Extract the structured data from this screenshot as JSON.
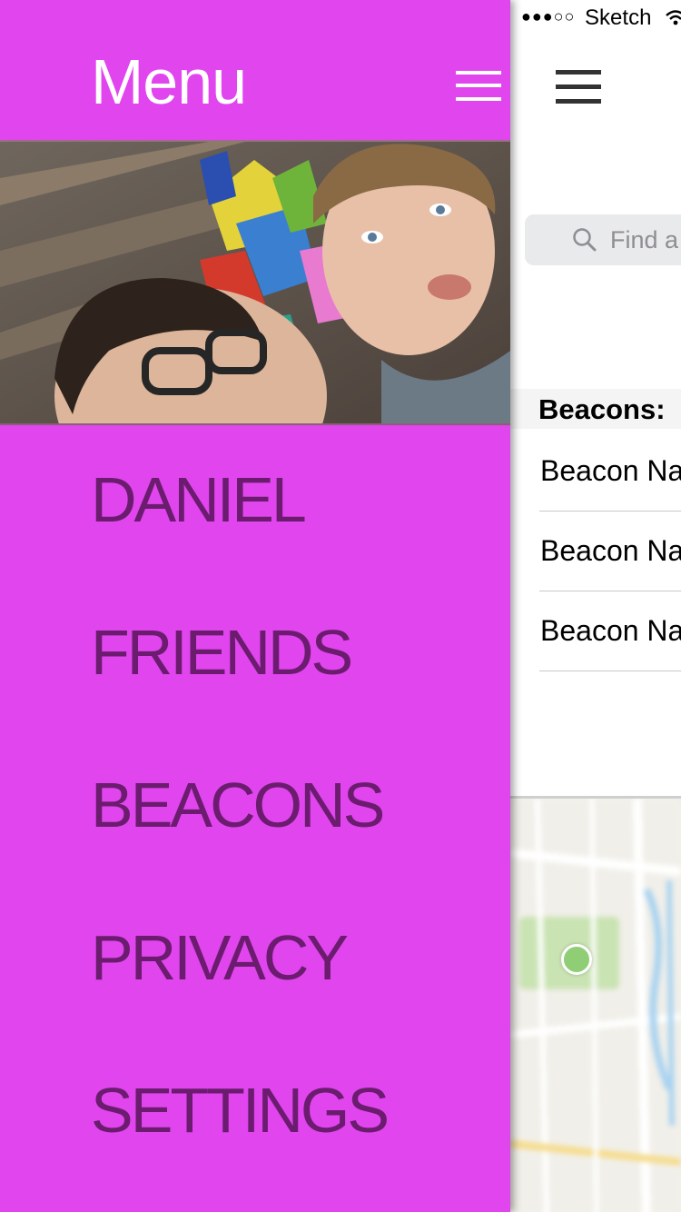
{
  "status_bar": {
    "signal": "●●●○○",
    "carrier": "Sketch"
  },
  "drawer": {
    "title": "Menu",
    "items": [
      {
        "label": "DANIEL"
      },
      {
        "label": "FRIENDS"
      },
      {
        "label": "BEACONS"
      },
      {
        "label": "PRIVACY"
      },
      {
        "label": "SETTINGS"
      }
    ],
    "background_color": "#e045ee",
    "item_color": "#6b1c6e"
  },
  "main": {
    "search": {
      "placeholder": "Find a"
    },
    "section_title": "Beacons:",
    "beacons": [
      {
        "name": "Beacon Na"
      },
      {
        "name": "Beacon Na"
      },
      {
        "name": "Beacon Na"
      }
    ]
  }
}
